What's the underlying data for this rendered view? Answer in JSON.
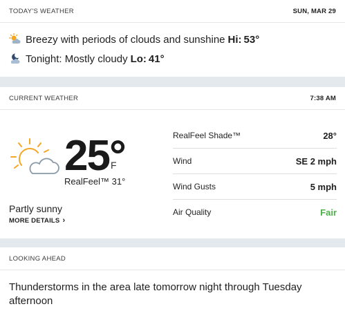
{
  "today": {
    "header": "TODAY'S WEATHER",
    "date": "SUN, MAR 29",
    "day": {
      "icon": "sun-cloud-icon",
      "text": "Breezy with periods of clouds and sunshine",
      "label": "Hi:",
      "value": "53°"
    },
    "night": {
      "icon": "moon-cloud-icon",
      "text": "Tonight: Mostly cloudy",
      "label": "Lo:",
      "value": "41°"
    }
  },
  "current": {
    "header": "CURRENT WEATHER",
    "time": "7:38 AM",
    "icon": "partly-sunny-icon",
    "temperature": "25°",
    "unit": "F",
    "realfeel": "RealFeel™ 31°",
    "condition": "Partly sunny",
    "more_details": "MORE DETAILS",
    "metrics": [
      {
        "label": "RealFeel Shade™",
        "value": "28°"
      },
      {
        "label": "Wind",
        "value": "SE 2 mph"
      },
      {
        "label": "Wind Gusts",
        "value": "5 mph"
      },
      {
        "label": "Air Quality",
        "value": "Fair"
      }
    ]
  },
  "ahead": {
    "header": "LOOKING AHEAD",
    "text": "Thunderstorms in the area late tomorrow night through Tuesday afternoon"
  },
  "colors": {
    "accent_sun": "#f5a623",
    "air_quality_fair": "#4fb04a",
    "page_bg": "#e4e9ee"
  }
}
